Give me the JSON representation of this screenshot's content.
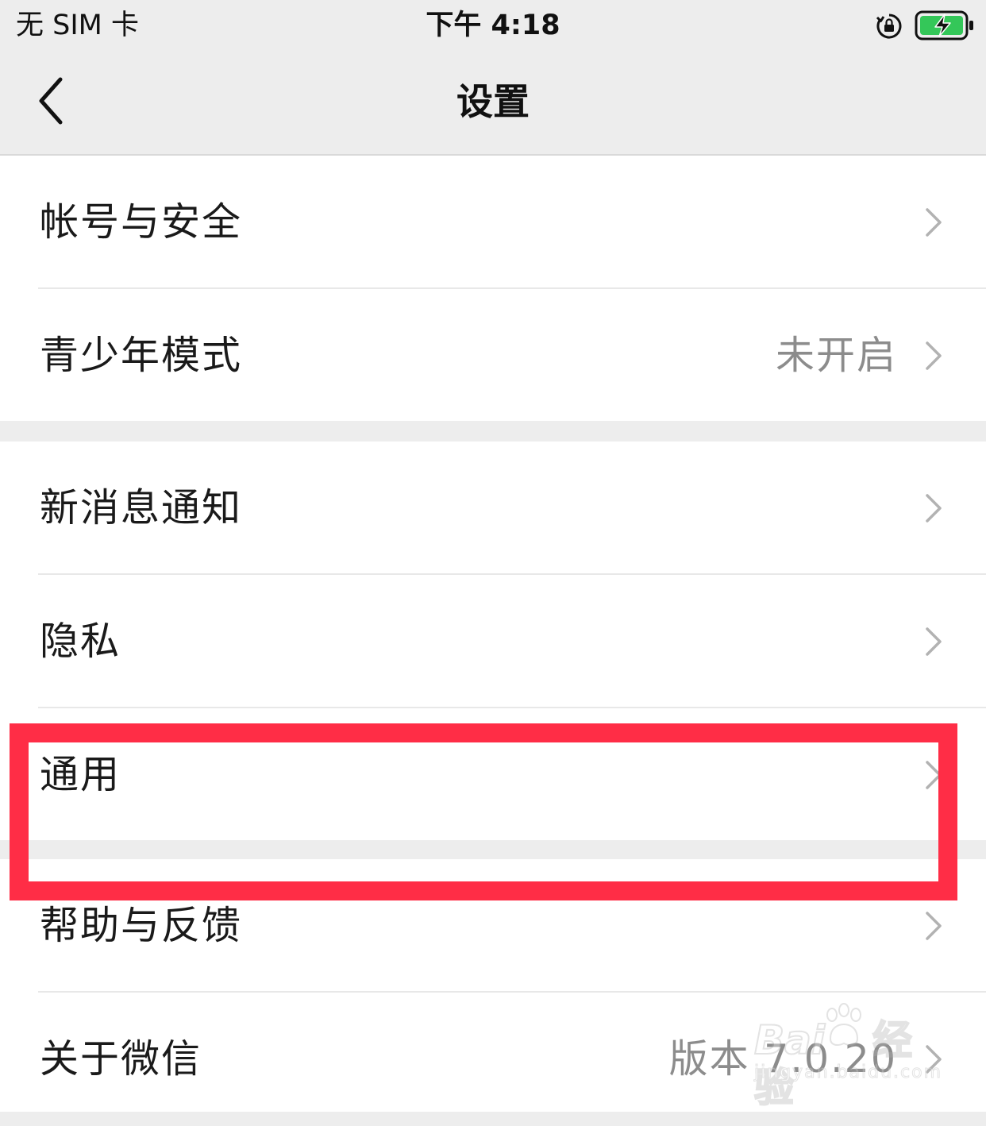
{
  "status_bar": {
    "carrier": "无 SIM 卡",
    "time": "下午 4:18",
    "lock_icon": "orientation-lock-icon",
    "battery_icon": "battery-charging-icon",
    "battery_color": "#34c759"
  },
  "nav": {
    "back_icon": "chevron-left-icon",
    "title": "设置"
  },
  "groups": [
    {
      "items": [
        {
          "label": "帐号与安全",
          "value": ""
        },
        {
          "label": "青少年模式",
          "value": "未开启"
        }
      ]
    },
    {
      "items": [
        {
          "label": "新消息通知",
          "value": ""
        },
        {
          "label": "隐私",
          "value": ""
        },
        {
          "label": "通用",
          "value": ""
        }
      ]
    },
    {
      "items": [
        {
          "label": "帮助与反馈",
          "value": ""
        },
        {
          "label": "关于微信",
          "value": "版本 7.0.20"
        }
      ]
    }
  ],
  "highlight": {
    "target": "通用",
    "color": "#ff2d46"
  },
  "watermark": {
    "brand": "Bai",
    "brand_suffix": "经验",
    "site": "jingyan.baidu.com"
  },
  "colors": {
    "background": "#ededed",
    "cell": "#ffffff",
    "secondary_text": "#8c8c8c",
    "chevron": "#b2b2b2"
  }
}
